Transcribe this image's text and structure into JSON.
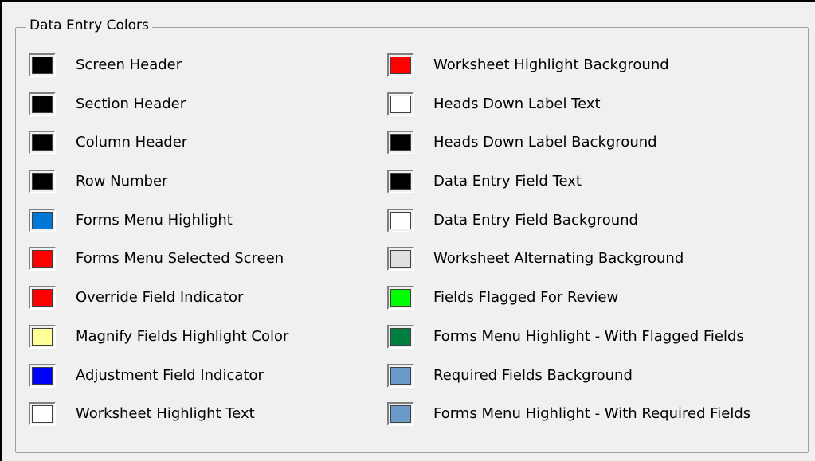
{
  "group": {
    "title": "Data Entry Colors"
  },
  "left_items": [
    {
      "label": "Screen Header",
      "color": "#000000"
    },
    {
      "label": "Section Header",
      "color": "#000000"
    },
    {
      "label": "Column Header",
      "color": "#000000"
    },
    {
      "label": "Row Number",
      "color": "#000000"
    },
    {
      "label": "Forms Menu Highlight",
      "color": "#0078d7"
    },
    {
      "label": "Forms Menu Selected Screen",
      "color": "#ff0000"
    },
    {
      "label": "Override Field Indicator",
      "color": "#ff0000"
    },
    {
      "label": "Magnify Fields Highlight Color",
      "color": "#ffff99"
    },
    {
      "label": "Adjustment Field Indicator",
      "color": "#0000ff"
    },
    {
      "label": "Worksheet Highlight Text",
      "color": "#ffffff"
    }
  ],
  "right_items": [
    {
      "label": "Worksheet Highlight Background",
      "color": "#ff0000"
    },
    {
      "label": "Heads Down Label Text",
      "color": "#ffffff"
    },
    {
      "label": "Heads Down Label Background",
      "color": "#000000"
    },
    {
      "label": "Data Entry Field Text",
      "color": "#000000"
    },
    {
      "label": "Data Entry Field Background",
      "color": "#ffffff"
    },
    {
      "label": "Worksheet Alternating Background",
      "color": "#e0e0e0"
    },
    {
      "label": "Fields Flagged For Review",
      "color": "#00ff00"
    },
    {
      "label": "Forms Menu Highlight - With Flagged Fields",
      "color": "#008040"
    },
    {
      "label": "Required Fields Background",
      "color": "#6b9bc8"
    },
    {
      "label": "Forms Menu Highlight - With Required Fields",
      "color": "#6b9bc8"
    }
  ]
}
